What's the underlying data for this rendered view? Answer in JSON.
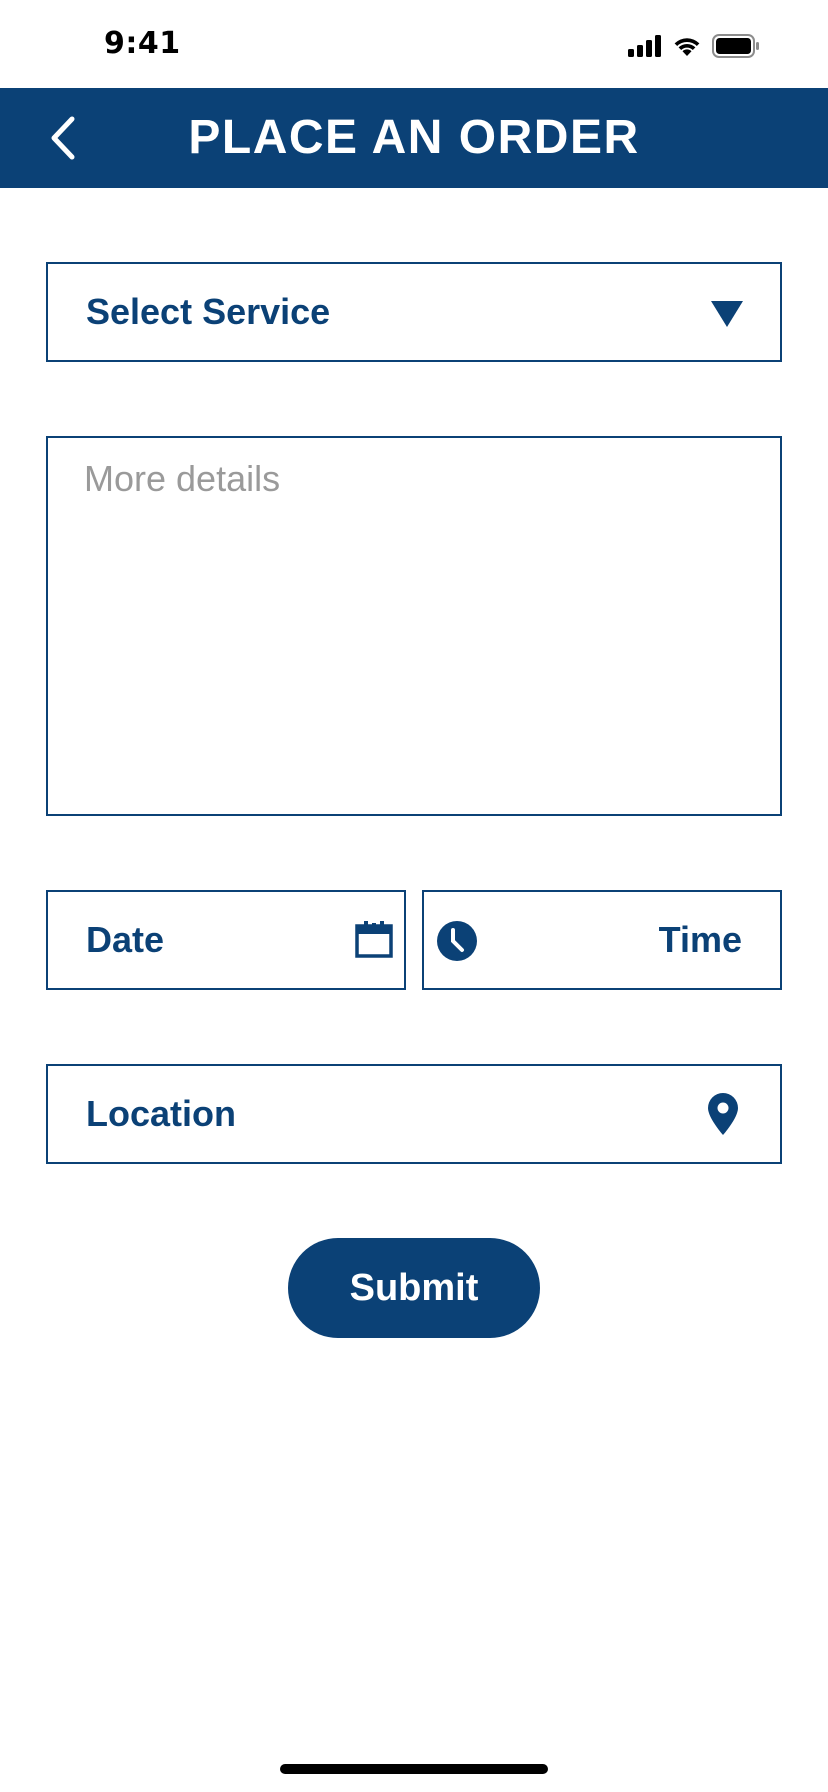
{
  "status_bar": {
    "time": "9:41",
    "icons": [
      "signal-icon",
      "wifi-icon",
      "battery-icon"
    ]
  },
  "header": {
    "title": "PLACE AN ORDER",
    "back_icon": "chevron-left-icon",
    "background_color": "#0b4176"
  },
  "form": {
    "service": {
      "label": "Select Service",
      "icon": "caret-down-icon"
    },
    "details": {
      "placeholder": "More details",
      "value": ""
    },
    "date": {
      "label": "Date",
      "icon": "calendar-icon"
    },
    "time": {
      "label": "Time",
      "icon": "clock-icon"
    },
    "location": {
      "label": "Location",
      "icon": "map-pin-icon"
    },
    "submit_label": "Submit"
  },
  "colors": {
    "primary": "#0b4176",
    "placeholder": "#9a9a9a",
    "background": "#ffffff"
  }
}
